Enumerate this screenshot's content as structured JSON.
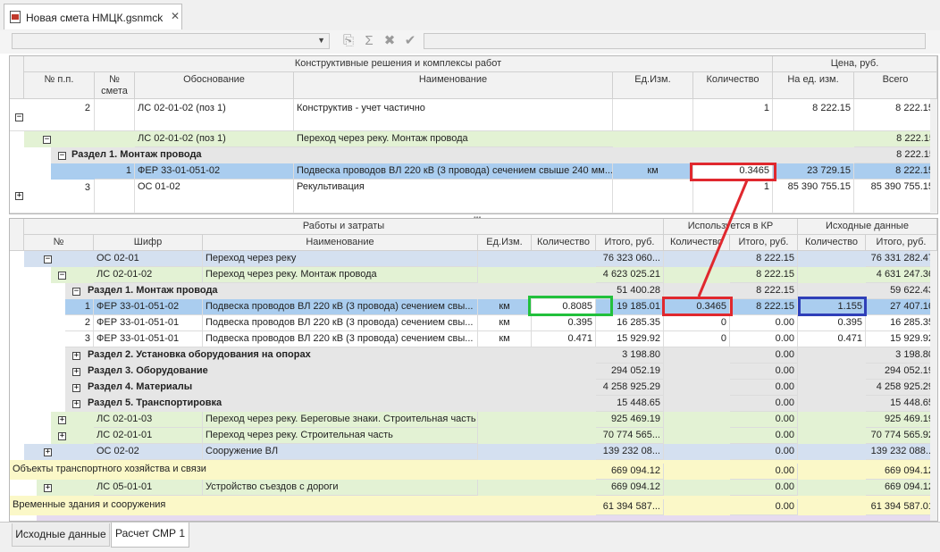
{
  "window": {
    "tab_title": "Новая смета НМЦК.gsnmck"
  },
  "top_grid": {
    "group_headers": {
      "constructive": "Конструктивные решения и комплексы работ",
      "price": "Цена, руб."
    },
    "columns": [
      "№ п.п.",
      "№ смета",
      "Обоснование",
      "Наименование",
      "Ед.Изм.",
      "Количество",
      "На ед. изм.",
      "Всего"
    ],
    "rows": [
      {
        "num": "2",
        "basis": "ЛС 02-01-02 (поз 1)",
        "name": "Конструктив - учет частично",
        "unit": "",
        "qty": "1",
        "per_unit": "8 222.15",
        "total": "8 222.15"
      },
      {
        "basis": "ЛС 02-01-02 (поз 1)",
        "name": "Переход через реку. Монтаж провода",
        "total": "8 222.15"
      },
      {
        "section": "Раздел 1. Монтаж провода",
        "total": "8 222.15"
      },
      {
        "idx": "1",
        "basis": "ФЕР 33-01-051-02",
        "name": "Подвеска проводов ВЛ 220 кВ (3 провода) сечением свыше 240 мм...",
        "unit": "км",
        "qty": "0.3465",
        "per_unit": "23 729.15",
        "total": "8 222.15"
      },
      {
        "num": "3",
        "basis": "ОС 01-02",
        "name": "Рекультивация",
        "qty": "1",
        "per_unit": "85 390 755.15",
        "total": "85 390 755.15"
      }
    ]
  },
  "bottom_grid": {
    "group_headers": {
      "works": "Работы и затраты",
      "used": "Используется в КР",
      "source": "Исходные данные"
    },
    "columns": [
      "№",
      "Шифр",
      "Наименование",
      "Ед.Изм.",
      "Количество",
      "Итого, руб.",
      "Количество",
      "Итого, руб.",
      "Количество",
      "Итого, руб."
    ],
    "rows": [
      {
        "code": "ОС 02-01",
        "name": "Переход через реку",
        "total": "76 323 060...",
        "used_total": "8 222.15",
        "src_total": "76 331 282.47"
      },
      {
        "code": "ЛС 02-01-02",
        "name": "Переход через реку. Монтаж провода",
        "total": "4 623 025.21",
        "used_total": "8 222.15",
        "src_total": "4 631 247.36"
      },
      {
        "section": "Раздел 1. Монтаж провода",
        "total": "51 400.28",
        "used_total": "8 222.15",
        "src_total": "59 622.43"
      },
      {
        "num": "1",
        "code": "ФЕР 33-01-051-02",
        "name": "Подвеска проводов ВЛ 220 кВ (3 провода) сечением свы...",
        "unit": "км",
        "qty": "0.8085",
        "total": "19 185.01",
        "used_qty": "0.3465",
        "used_total": "8 222.15",
        "src_qty": "1.155",
        "src_total": "27 407.16"
      },
      {
        "num": "2",
        "code": "ФЕР 33-01-051-01",
        "name": "Подвеска проводов ВЛ 220 кВ (3 провода) сечением свы...",
        "unit": "км",
        "qty": "0.395",
        "total": "16 285.35",
        "used_qty": "0",
        "used_total": "0.00",
        "src_qty": "0.395",
        "src_total": "16 285.35"
      },
      {
        "num": "3",
        "code": "ФЕР 33-01-051-01",
        "name": "Подвеска проводов ВЛ 220 кВ (3 провода) сечением свы...",
        "unit": "км",
        "qty": "0.471",
        "total": "15 929.92",
        "used_qty": "0",
        "used_total": "0.00",
        "src_qty": "0.471",
        "src_total": "15 929.92"
      },
      {
        "section": "Раздел 2. Установка оборудования на опорах",
        "total": "3 198.80",
        "used_total": "0.00",
        "src_total": "3 198.80"
      },
      {
        "section": "Раздел 3. Оборудование",
        "total": "294 052.19",
        "used_total": "0.00",
        "src_total": "294 052.19"
      },
      {
        "section": "Раздел 4. Материалы",
        "total": "4 258 925.29",
        "used_total": "0.00",
        "src_total": "4 258 925.29"
      },
      {
        "section": "Раздел 5. Транспортировка",
        "total": "15 448.65",
        "used_total": "0.00",
        "src_total": "15 448.65"
      },
      {
        "code": "ЛС 02-01-03",
        "name": "Переход через реку. Береговые знаки. Строительная часть",
        "total": "925 469.19",
        "used_total": "0.00",
        "src_total": "925 469.19"
      },
      {
        "code": "ЛС 02-01-01",
        "name": "Переход через реку. Строительная часть",
        "total": "70 774 565...",
        "used_total": "0.00",
        "src_total": "70 774 565.92"
      },
      {
        "code": "ОС 02-02",
        "name": "Сооружение ВЛ",
        "total": "139 232 08...",
        "used_total": "0.00",
        "src_total": "139 232 088..."
      },
      {
        "group": "Объекты транспортного хозяйства и связи",
        "total": "669 094.12",
        "used_total": "0.00",
        "src_total": "669 094.12"
      },
      {
        "code": "ЛС 05-01-01",
        "name": "Устройство съездов с дороги",
        "total": "669 094.12",
        "used_total": "0.00",
        "src_total": "669 094.12"
      },
      {
        "group": "Временные здания и сооружения",
        "total": "61 394 587...",
        "used_total": "0.00",
        "src_total": "61 394 587.01"
      }
    ]
  },
  "bottom_tabs": [
    "Исходные данные",
    "Расчет СМР 1"
  ],
  "colors": {
    "highlight_red": "#e0282e",
    "highlight_green": "#22c03c",
    "highlight_blue": "#2f3fb8",
    "row_selected": "#aacdef"
  },
  "icons": [
    "file-icon",
    "close-icon",
    "copy-icon",
    "sigma-icon",
    "delete-icon",
    "check-icon",
    "chevron-down-icon",
    "expand-icon",
    "collapse-icon"
  ]
}
